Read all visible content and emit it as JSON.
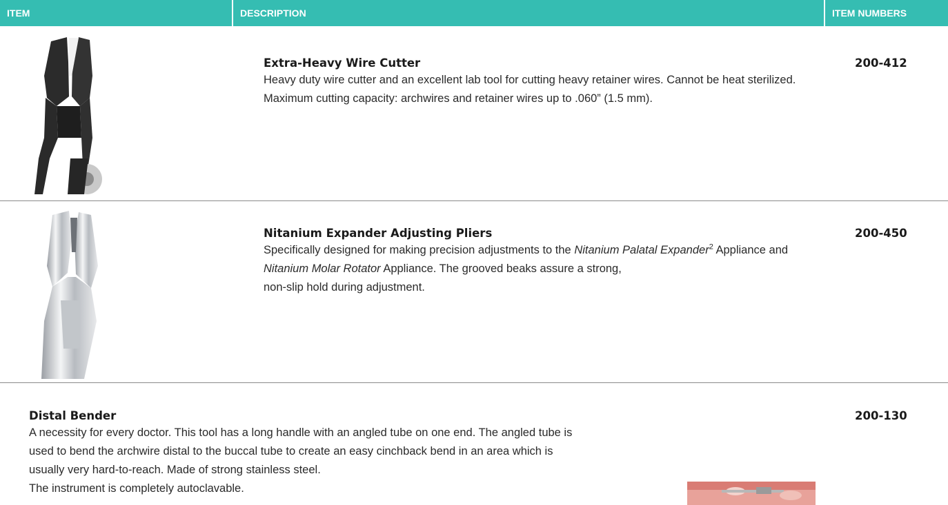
{
  "header": {
    "item": "ITEM",
    "description": "DESCRIPTION",
    "item_numbers": "ITEM NUMBERS"
  },
  "colors": {
    "accent": "#35bdb2",
    "divider": "#8a8a8a"
  },
  "products": [
    {
      "image_icon": "wire-cutter-photo",
      "name": "Extra-Heavy Wire Cutter",
      "description": "Heavy duty wire cutter and an excellent lab tool for cutting heavy retainer wires. Cannot be heat sterilized. Maximum cutting capacity: archwires and retainer wires up to .060” (1.5 mm).",
      "item_number": "200-412"
    },
    {
      "image_icon": "expander-pliers-photo",
      "name": "Nitanium Expander Adjusting Pliers",
      "desc_part1": "Specifically designed for making precision adjustments to the ",
      "desc_em1": "Nitanium Palatal Expander",
      "desc_sup": "2",
      "desc_part2": " Appliance and ",
      "desc_em2": "Nitanium Molar Rotator",
      "desc_part3": " Appliance. The grooved beaks assure a strong,",
      "desc_line2": "non-slip hold during adjustment.",
      "item_number": "200-450"
    },
    {
      "image_icon": "distal-bender-photo",
      "name": "Distal Bender",
      "description": "A necessity for every doctor. This tool has a long handle with an angled tube on one end. The angled tube is used to bend the archwire distal to the buccal tube to create an easy cinchback bend in an area which is usually very hard-to-reach. Made of strong stainless steel.",
      "desc_line2": "The instrument is completely autoclavable.",
      "item_number": "200-130"
    }
  ]
}
